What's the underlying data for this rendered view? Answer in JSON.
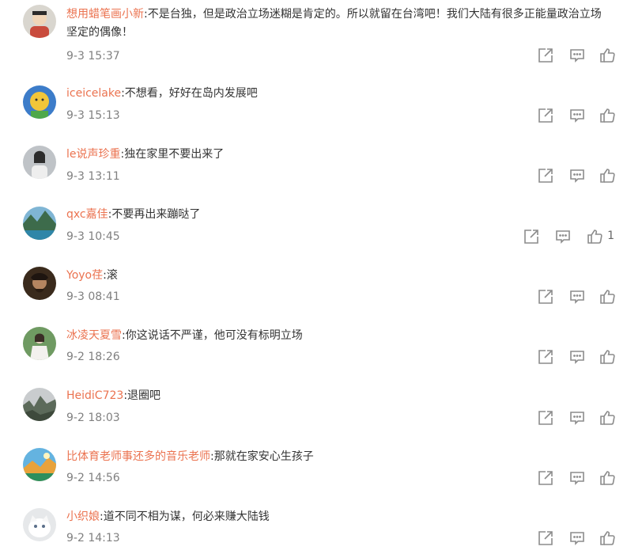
{
  "comments": [
    {
      "user": "想用蜡笔画小新",
      "text": ":不是台独，但是政治立场迷糊是肯定的。所以就留在台湾吧！我们大陆有很多正能量政治立场坚定的偶像！",
      "time": "9-3 15:37",
      "likes": ""
    },
    {
      "user": "iceicelake",
      "text": ":不想看，好好在岛内发展吧",
      "time": "9-3 15:13",
      "likes": ""
    },
    {
      "user": "le说声珍重",
      "text": ":独在家里不要出来了",
      "time": "9-3 13:11",
      "likes": ""
    },
    {
      "user": "qxc嘉佳",
      "text": ":不要再出来蹦哒了",
      "time": "9-3 10:45",
      "likes": "1"
    },
    {
      "user": "Yoyo荏",
      "text": ":滚",
      "time": "9-3 08:41",
      "likes": ""
    },
    {
      "user": "冰凌天夏雪",
      "text": ":你这说话不严谨，他可没有标明立场",
      "time": "9-2 18:26",
      "likes": ""
    },
    {
      "user": "HeidiC723",
      "text": ":退圈吧",
      "time": "9-2 18:03",
      "likes": ""
    },
    {
      "user": "比体育老师事还多的音乐老师",
      "text": ":那就在家安心生孩子",
      "time": "9-2 14:56",
      "likes": ""
    },
    {
      "user": "小织娘",
      "text": ":道不同不相为谋，何必来赚大陆钱",
      "time": "9-2 14:13",
      "likes": ""
    }
  ],
  "colors": {
    "username": "#eb7350",
    "time": "#808080",
    "icon": "#8c8c8c"
  },
  "icons": [
    "share-icon",
    "comment-icon",
    "like-icon"
  ]
}
